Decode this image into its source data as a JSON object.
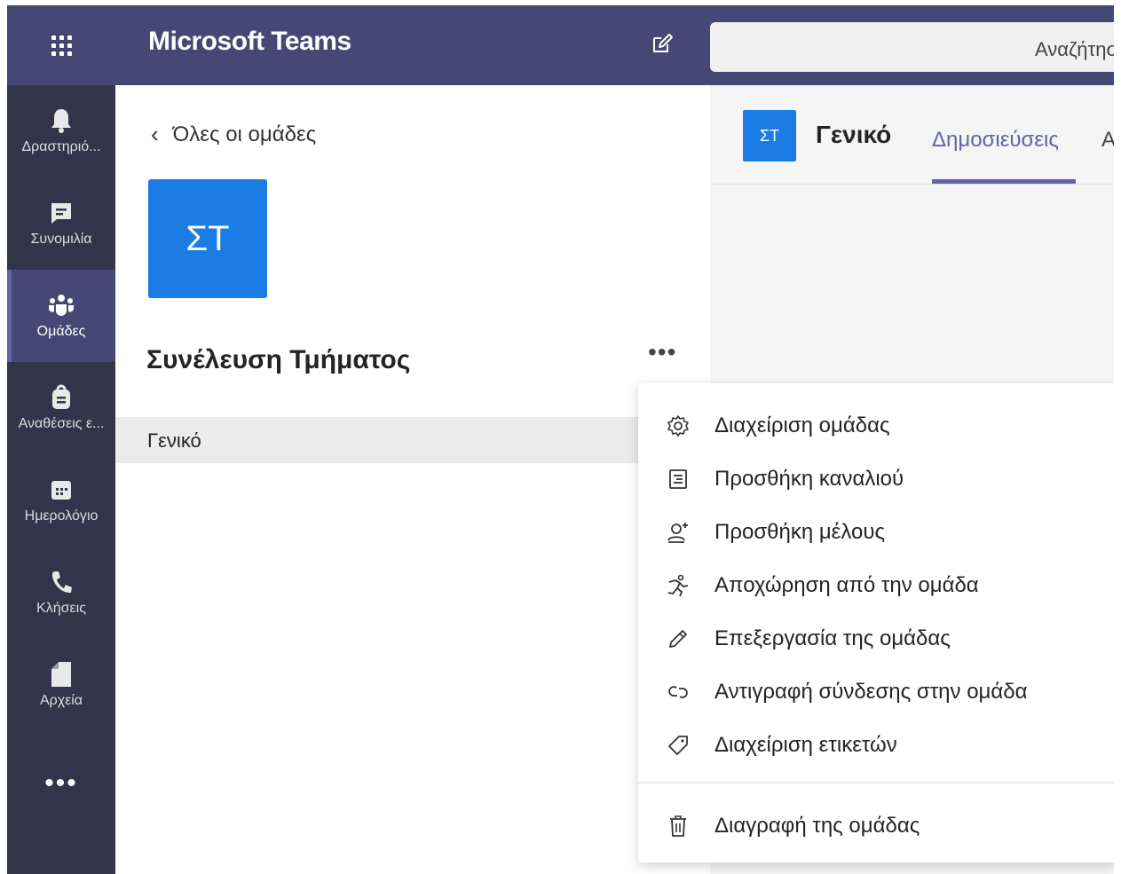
{
  "app": {
    "title": "Microsoft Teams",
    "search_placeholder": "Αναζήτηση"
  },
  "appbar": {
    "items": [
      {
        "label": "Δραστηριότητα",
        "display": "Δραστηριό...",
        "icon": "bell-icon"
      },
      {
        "label": "Συνομιλία",
        "display": "Συνομιλία",
        "icon": "chat-icon"
      },
      {
        "label": "Ομάδες",
        "display": "Ομάδες",
        "icon": "teams-icon",
        "active": true
      },
      {
        "label": "Αναθέσεις εργασιών",
        "display": "Αναθέσεις ε...",
        "icon": "assignments-icon"
      },
      {
        "label": "Ημερολόγιο",
        "display": "Ημερολόγιο",
        "icon": "calendar-icon"
      },
      {
        "label": "Κλήσεις",
        "display": "Κλήσεις",
        "icon": "phone-icon"
      },
      {
        "label": "Αρχεία",
        "display": "Αρχεία",
        "icon": "file-icon"
      }
    ],
    "more": "•••"
  },
  "panel": {
    "back_label": "Όλες οι ομάδες",
    "team_initials": "ΣΤ",
    "team_name": "Συνέλευση Τμήματος",
    "more": "•••",
    "channels": [
      {
        "name": "Γενικό"
      }
    ]
  },
  "channel": {
    "initials": "ΣΤ",
    "name": "Γενικό",
    "tabs": [
      {
        "label": "Δημοσιεύσεις",
        "active": true
      },
      {
        "label": "Α"
      }
    ]
  },
  "menu": {
    "items": [
      {
        "label": "Διαχείριση ομάδας",
        "icon": "gear-icon"
      },
      {
        "label": "Προσθήκη καναλιού",
        "icon": "add-channel-icon"
      },
      {
        "label": "Προσθήκη μέλους",
        "icon": "add-member-icon"
      },
      {
        "label": "Αποχώρηση από την ομάδα",
        "icon": "leave-icon"
      },
      {
        "label": "Επεξεργασία της ομάδας",
        "icon": "pencil-icon"
      },
      {
        "label": "Αντιγραφή σύνδεσης στην ομάδα",
        "icon": "link-icon"
      },
      {
        "label": "Διαχείριση ετικετών",
        "icon": "tag-icon"
      }
    ],
    "delete_label": "Διαγραφή της ομάδας",
    "delete_icon": "trash-icon"
  },
  "colors": {
    "titlebar": "#464775",
    "appbar": "#33344a",
    "accent": "#6264a7",
    "avatar": "#1b7ce6"
  }
}
